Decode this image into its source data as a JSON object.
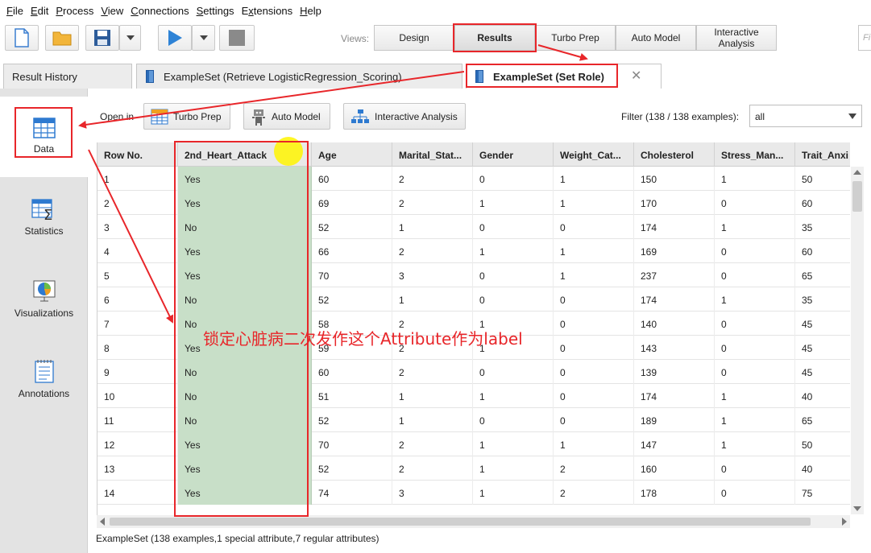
{
  "menu": [
    {
      "pre": "",
      "u": "F",
      "post": "ile"
    },
    {
      "pre": "",
      "u": "E",
      "post": "dit"
    },
    {
      "pre": "",
      "u": "P",
      "post": "rocess"
    },
    {
      "pre": "",
      "u": "V",
      "post": "iew"
    },
    {
      "pre": "",
      "u": "C",
      "post": "onnections"
    },
    {
      "pre": "",
      "u": "S",
      "post": "ettings"
    },
    {
      "pre": "E",
      "u": "x",
      "post": "tensions"
    },
    {
      "pre": "",
      "u": "H",
      "post": "elp"
    }
  ],
  "toolbar": {
    "views_label": "Views:",
    "views": [
      "Design",
      "Results",
      "Turbo Prep",
      "Auto Model",
      "Interactive\nAnalysis"
    ],
    "active_view": "Results",
    "search_placeholder": "Fi"
  },
  "tabs": {
    "history": "Result History",
    "tab1": "ExampleSet (Retrieve LogisticRegression_Scoring)",
    "tab2": "ExampleSet (Set Role)"
  },
  "sidebar": [
    "Data",
    "Statistics",
    "Visualizations",
    "Annotations"
  ],
  "open_in": {
    "label": "Open in",
    "buttons": [
      "Turbo Prep",
      "Auto Model",
      "Interactive Analysis"
    ]
  },
  "filter": {
    "label": "Filter (138 / 138 examples):",
    "value": "all"
  },
  "table": {
    "headers": [
      "Row No.",
      "2nd_Heart_Attack",
      "Age",
      "Marital_Stat...",
      "Gender",
      "Weight_Cat...",
      "Cholesterol",
      "Stress_Man...",
      "Trait_Anxi"
    ],
    "rows": [
      [
        "1",
        "Yes",
        "60",
        "2",
        "0",
        "1",
        "150",
        "1",
        "50"
      ],
      [
        "2",
        "Yes",
        "69",
        "2",
        "1",
        "1",
        "170",
        "0",
        "60"
      ],
      [
        "3",
        "No",
        "52",
        "1",
        "0",
        "0",
        "174",
        "1",
        "35"
      ],
      [
        "4",
        "Yes",
        "66",
        "2",
        "1",
        "1",
        "169",
        "0",
        "60"
      ],
      [
        "5",
        "Yes",
        "70",
        "3",
        "0",
        "1",
        "237",
        "0",
        "65"
      ],
      [
        "6",
        "No",
        "52",
        "1",
        "0",
        "0",
        "174",
        "1",
        "35"
      ],
      [
        "7",
        "No",
        "58",
        "2",
        "1",
        "0",
        "140",
        "0",
        "45"
      ],
      [
        "8",
        "Yes",
        "59",
        "2",
        "1",
        "0",
        "143",
        "0",
        "45"
      ],
      [
        "9",
        "No",
        "60",
        "2",
        "0",
        "0",
        "139",
        "0",
        "45"
      ],
      [
        "10",
        "No",
        "51",
        "1",
        "1",
        "0",
        "174",
        "1",
        "40"
      ],
      [
        "11",
        "No",
        "52",
        "1",
        "0",
        "0",
        "189",
        "1",
        "65"
      ],
      [
        "12",
        "Yes",
        "70",
        "2",
        "1",
        "1",
        "147",
        "1",
        "50"
      ],
      [
        "13",
        "Yes",
        "52",
        "2",
        "1",
        "2",
        "160",
        "0",
        "40"
      ],
      [
        "14",
        "Yes",
        "74",
        "3",
        "1",
        "2",
        "178",
        "0",
        "75"
      ]
    ]
  },
  "status": "ExampleSet (138 examples,1 special attribute,7 regular attributes)",
  "annotation_note": "锁定心脏病二次发作这个Attribute作为label",
  "colors": {
    "accent_red": "#e8262a",
    "label_column": "#c8dfc8"
  }
}
